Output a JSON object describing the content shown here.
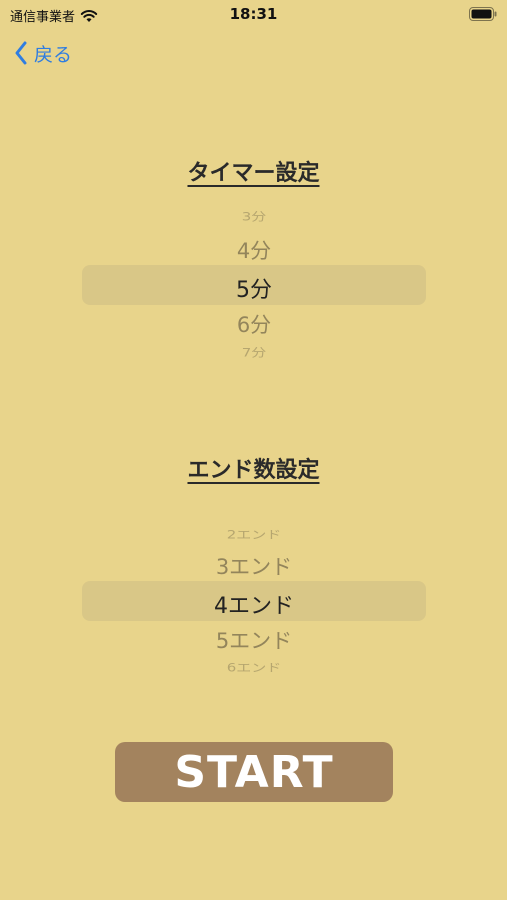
{
  "status_bar": {
    "carrier": "通信事業者",
    "time": "18:31"
  },
  "nav": {
    "back_label": "戻る"
  },
  "timer": {
    "title": "タイマー設定",
    "options": [
      "3分",
      "4分",
      "5分",
      "6分",
      "7分"
    ],
    "selected": "5分"
  },
  "ends": {
    "title": "エンド数設定",
    "options": [
      "2エンド",
      "3エンド",
      "4エンド",
      "5エンド",
      "6エンド"
    ],
    "selected": "4エンド"
  },
  "start_label": "START",
  "colors": {
    "background": "#e8d48b",
    "accent": "#2f7de1",
    "start_button": "#a3835e"
  }
}
